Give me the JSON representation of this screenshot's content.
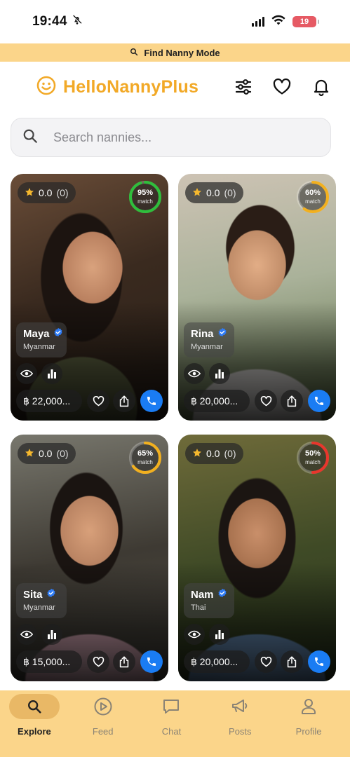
{
  "status_bar": {
    "time": "19:44",
    "battery": "19"
  },
  "mode_banner": {
    "label": "Find Nanny Mode"
  },
  "header": {
    "app_name": "HelloNannyPlus"
  },
  "search": {
    "placeholder": "Search nannies..."
  },
  "nannies": [
    {
      "name": "Maya",
      "country": "Myanmar",
      "rating": "0.0",
      "reviews": "(0)",
      "match_pct": "95%",
      "match_label": "match",
      "match_value": 0.95,
      "ring_color": "#2fbe3c",
      "price": "฿ 22,000..."
    },
    {
      "name": "Rina",
      "country": "Myanmar",
      "rating": "0.0",
      "reviews": "(0)",
      "match_pct": "60%",
      "match_label": "match",
      "match_value": 0.6,
      "ring_color": "#f2b01f",
      "price": "฿ 20,000..."
    },
    {
      "name": "Sita",
      "country": "Myanmar",
      "rating": "0.0",
      "reviews": "(0)",
      "match_pct": "65%",
      "match_label": "match",
      "match_value": 0.65,
      "ring_color": "#f2b01f",
      "price": "฿ 15,000..."
    },
    {
      "name": "Nam",
      "country": "Thai",
      "rating": "0.0",
      "reviews": "(0)",
      "match_pct": "50%",
      "match_label": "match",
      "match_value": 0.5,
      "ring_color": "#e8362c",
      "price": "฿ 20,000..."
    }
  ],
  "bottom_nav": [
    {
      "label": "Explore",
      "icon": "search-icon",
      "active": true
    },
    {
      "label": "Feed",
      "icon": "play-circle-icon",
      "active": false
    },
    {
      "label": "Chat",
      "icon": "chat-bubble-icon",
      "active": false
    },
    {
      "label": "Posts",
      "icon": "megaphone-icon",
      "active": false
    },
    {
      "label": "Profile",
      "icon": "person-icon",
      "active": false
    }
  ],
  "colors": {
    "accent": "#fbd58a",
    "brand": "#f2a927",
    "call": "#1a7cf3",
    "verified": "#2f7cf6"
  }
}
